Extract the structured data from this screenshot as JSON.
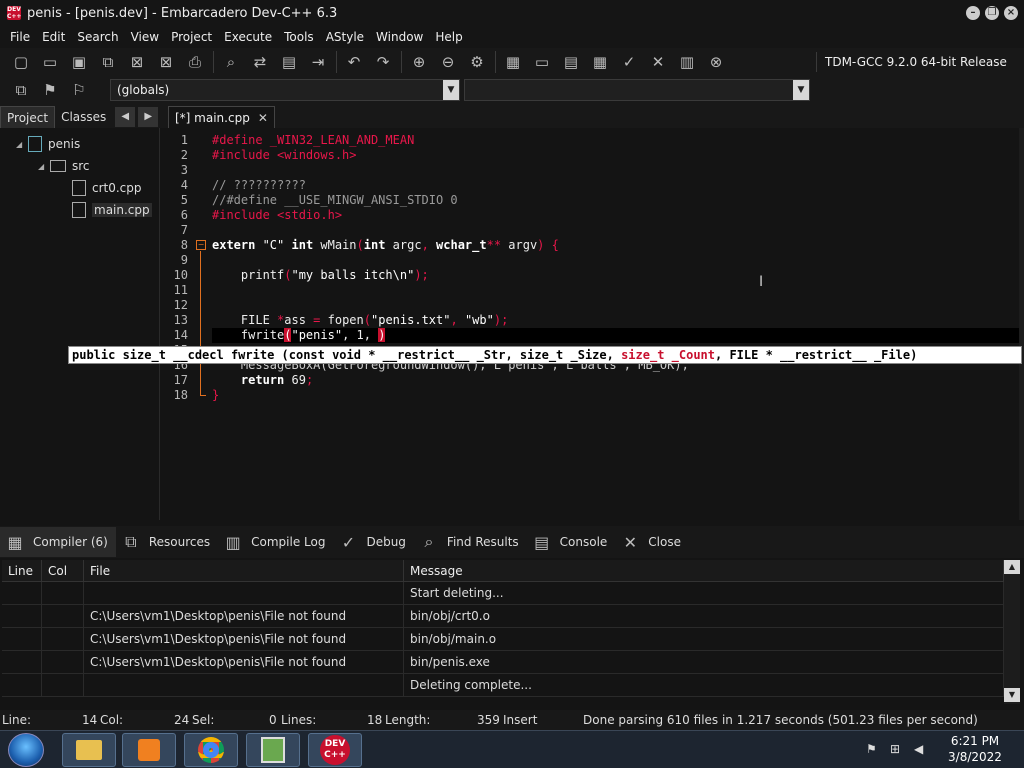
{
  "window": {
    "title": "penis - [penis.dev] - Embarcadero Dev-C++ 6.3",
    "icon_label": "DEV C++"
  },
  "menu": [
    "File",
    "Edit",
    "Search",
    "View",
    "Project",
    "Execute",
    "Tools",
    "AStyle",
    "Window",
    "Help"
  ],
  "toolbar": {
    "compiler": "TDM-GCC 9.2.0 64-bit Release",
    "scope": "(globals)"
  },
  "left_panel": {
    "tabs": [
      "Project",
      "Classes"
    ],
    "tree": {
      "project": "penis",
      "folder": "src",
      "files": [
        "crt0.cpp",
        "main.cpp"
      ]
    }
  },
  "editor": {
    "tab": "[*] main.cpp",
    "line_numbers": [
      "1",
      "2",
      "3",
      "4",
      "5",
      "6",
      "7",
      "8",
      "9",
      "10",
      "11",
      "12",
      "13",
      "14",
      "15",
      "16",
      "17",
      "18"
    ],
    "lines": {
      "l1": "#define _WIN32_LEAN_AND_MEAN",
      "l2a": "#include ",
      "l2b": "<windows.h>",
      "l4": "// ??????????",
      "l5": "//#define __USE_MINGW_ANSI_STDIO 0",
      "l6a": "#include ",
      "l6b": "<stdio.h>",
      "l8a": "extern ",
      "l8b": "\"C\"",
      "l8c": " int ",
      "l8d": "wMain",
      "l8e": "(",
      "l8f": "int",
      "l8g": " argc",
      "l8h": ", ",
      "l8i": "wchar_t",
      "l8j": "**",
      "l8k": " argv",
      "l8l": ") {",
      "l10a": "    printf",
      "l10b": "(",
      "l10c": "\"my balls itch\\n\"",
      "l10d": ");",
      "l13a": "    FILE ",
      "l13b": "*",
      "l13c": "ass ",
      "l13d": "=",
      "l13e": " fopen",
      "l13f": "(",
      "l13g": "\"penis.txt\"",
      "l13h": ", ",
      "l13i": "\"wb\"",
      "l13j": ");",
      "l14a": "    fwrite",
      "l14b": "(",
      "l14c": "\"penis\"",
      "l14d": ", 1, ",
      "l14e": ")",
      "l16": "    MessageBoxA(GetForegroundWindow(), L\"penis\", L\"balls\", MB_OK);",
      "l17a": "    return ",
      "l17b": "69",
      "l17c": ";",
      "l18": "}"
    },
    "tooltip": {
      "pre": "public size_t __cdecl fwrite (const void * __restrict__ _Str, size_t _Size, ",
      "hl": "size_t _Count",
      "post": ", FILE * __restrict__ _File)"
    }
  },
  "bottom_tabs": [
    "Compiler (6)",
    "Resources",
    "Compile Log",
    "Debug",
    "Find Results",
    "Console",
    "Close"
  ],
  "messages": {
    "headers": [
      "Line",
      "Col",
      "File",
      "Message"
    ],
    "rows": [
      {
        "line": "",
        "col": "",
        "file": "",
        "message": "Start deleting..."
      },
      {
        "line": "",
        "col": "",
        "file": "C:\\Users\\vm1\\Desktop\\penis\\File not found",
        "message": "bin/obj/crt0.o"
      },
      {
        "line": "",
        "col": "",
        "file": "C:\\Users\\vm1\\Desktop\\penis\\File not found",
        "message": "bin/obj/main.o"
      },
      {
        "line": "",
        "col": "",
        "file": "C:\\Users\\vm1\\Desktop\\penis\\File not found",
        "message": "bin/penis.exe"
      },
      {
        "line": "",
        "col": "",
        "file": "",
        "message": "Deleting complete..."
      }
    ]
  },
  "status": {
    "line_label": "Line:",
    "line_val": "14",
    "col_label": "Col:",
    "col_val": "24",
    "sel_label": "Sel:",
    "sel_val": "0",
    "lines_label": "Lines:",
    "lines_val": "18",
    "length_label": "Length:",
    "length_val": "359",
    "mode": "Insert",
    "parse": "Done parsing 610 files in 1.217 seconds (501.23 files per second)"
  },
  "taskbar": {
    "time": "6:21 PM",
    "date": "3/8/2022",
    "devcpp_label": "DEV C++"
  }
}
